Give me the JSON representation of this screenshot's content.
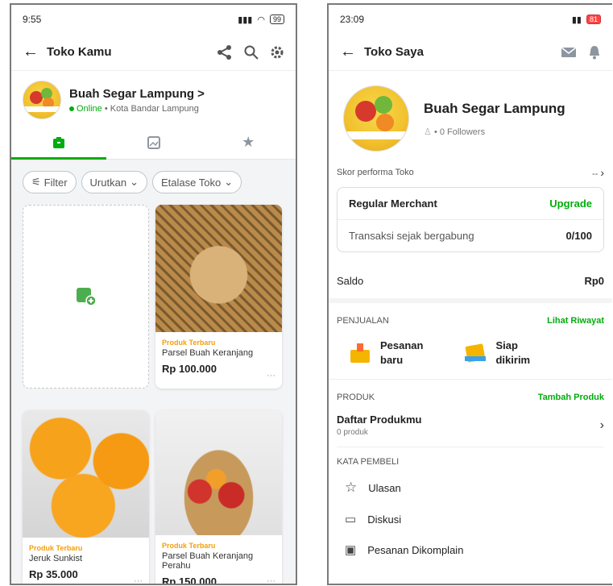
{
  "left": {
    "status": {
      "time": "9:55",
      "battery": "99"
    },
    "topbar": {
      "title": "Toko Kamu"
    },
    "shop": {
      "name": "Buah Segar Lampung >",
      "online": "Online",
      "location": "• Kota Bandar Lampung"
    },
    "filters": {
      "filter": "Filter",
      "sort": "Urutkan",
      "showcase": "Etalase Toko"
    },
    "products": [
      {
        "label": "Produk Terbaru",
        "name": "Parsel Buah Keranjang",
        "price": "Rp 100.000"
      },
      {
        "label": "Produk Terbaru",
        "name": "Jeruk Sunkist",
        "price": "Rp 35.000"
      },
      {
        "label": "Produk Terbaru",
        "name": "Parsel Buah Keranjang Perahu",
        "price": "Rp 150.000"
      }
    ]
  },
  "right": {
    "status": {
      "time": "23:09",
      "battery": "81"
    },
    "topbar": {
      "title": "Toko Saya"
    },
    "shop": {
      "name": "Buah Segar Lampung",
      "followers": "• 0 Followers"
    },
    "performance": {
      "label": "Skor performa Toko",
      "value": "--"
    },
    "merchant": {
      "type": "Regular Merchant",
      "upgrade": "Upgrade",
      "tx_label": "Transaksi sejak bergabung",
      "tx_value": "0/100"
    },
    "saldo": {
      "label": "Saldo",
      "value": "Rp0"
    },
    "sales": {
      "title": "PENJUALAN",
      "link": "Lihat Riwayat",
      "new_order": "Pesanan\nbaru",
      "ready": "Siap\ndikirim"
    },
    "product": {
      "title": "PRODUK",
      "link": "Tambah Produk",
      "list_title": "Daftar Produkmu",
      "list_sub": "0 produk"
    },
    "buyer": {
      "title": "KATA PEMBELI",
      "reviews": "Ulasan",
      "discussion": "Diskusi",
      "complaints": "Pesanan Dikomplain"
    }
  },
  "colors": {
    "accent": "#03ac0e",
    "label_new": "#f59e0b"
  }
}
